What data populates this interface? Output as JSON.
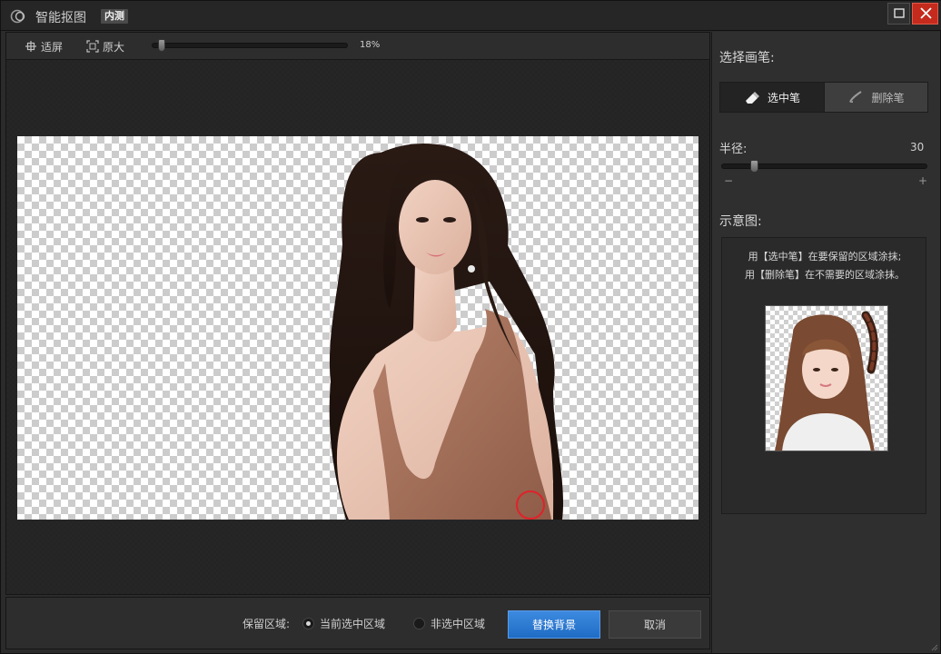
{
  "window": {
    "title": "智能抠图",
    "badge": "内测"
  },
  "toolbar": {
    "fit_label": "适屏",
    "original_label": "原大",
    "zoom_percent": 18,
    "zoom_text": "18%"
  },
  "canvas": {
    "checker_colors": [
      "#ffffff",
      "#cccccc"
    ],
    "brush_cursor_color": "#e0222a"
  },
  "bottom": {
    "keep_area_label": "保留区域:",
    "options": [
      {
        "label": "当前选中区域",
        "selected": true
      },
      {
        "label": "非选中区域",
        "selected": false
      }
    ],
    "replace_button": "替换背景",
    "cancel_button": "取消"
  },
  "panel": {
    "choose_pen_label": "选择画笔:",
    "pens": [
      {
        "label": "选中笔",
        "icon": "eraser-pen-icon",
        "active": true
      },
      {
        "label": "删除笔",
        "icon": "brush-delete-icon",
        "active": false
      }
    ],
    "radius_label": "半径:",
    "radius_value": "30",
    "minus": "−",
    "plus": "+",
    "demo_label": "示意图:",
    "demo_line1": "用【选中笔】在要保留的区域涂抹;",
    "demo_line2": "用【删除笔】在不需要的区域涂抹。"
  },
  "colors": {
    "accent": "#2a78d6",
    "close": "#c42b1c",
    "bg": "#2b2b2b"
  }
}
